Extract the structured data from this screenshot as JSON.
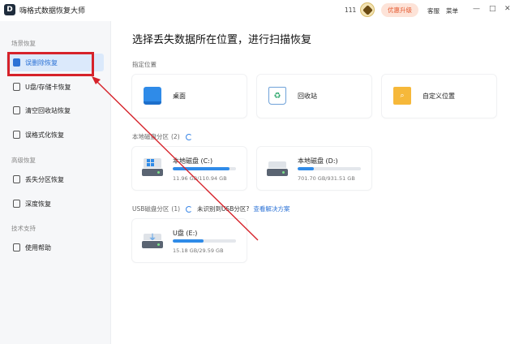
{
  "app": {
    "title": "嗨格式数据恢复大师",
    "logo_letter": "D"
  },
  "titlebar": {
    "count": "111",
    "upgrade_label": "优惠升级",
    "service_label": "客服",
    "menu_label": "菜单",
    "minimize_glyph": "—",
    "maximize_glyph": "□",
    "close_glyph": "✕"
  },
  "sidebar": {
    "sections": [
      {
        "label": "场景恢复",
        "items": [
          {
            "label": "误删除恢复",
            "icon": "file-delete-icon",
            "active": true
          },
          {
            "label": "U盘/存储卡恢复",
            "icon": "usb-icon"
          },
          {
            "label": "清空回收站恢复",
            "icon": "recycle-bin-icon"
          },
          {
            "label": "误格式化恢复",
            "icon": "format-icon"
          }
        ]
      },
      {
        "label": "高级恢复",
        "items": [
          {
            "label": "丢失分区恢复",
            "icon": "partition-icon"
          },
          {
            "label": "深度恢复",
            "icon": "deep-scan-icon"
          }
        ]
      },
      {
        "label": "技术支持",
        "items": [
          {
            "label": "使用帮助",
            "icon": "help-book-icon"
          }
        ]
      }
    ]
  },
  "main": {
    "title": "选择丢失数据所在位置，进行扫描恢复",
    "locations": {
      "label": "指定位置",
      "items": [
        {
          "label": "桌面",
          "icon": "desktop-icon"
        },
        {
          "label": "回收站",
          "icon": "recycle-bin-icon"
        },
        {
          "label": "自定义位置",
          "icon": "folder-search-icon"
        }
      ]
    },
    "local_disks": {
      "label": "本地磁盘分区",
      "count": "(2)",
      "items": [
        {
          "name": "本地磁盘 (C:)",
          "size": "11.96 GB/110.94 GB",
          "used_fraction": 0.9
        },
        {
          "name": "本地磁盘 (D:)",
          "size": "701.70 GB/931.51 GB",
          "used_fraction": 0.25
        }
      ]
    },
    "usb_disks": {
      "label": "USB磁盘分区",
      "count": "(1)",
      "warning": "未识别到USB分区?",
      "link": "查看解决方案",
      "items": [
        {
          "name": "U盘 (E:)",
          "size": "15.18 GB/29.59 GB",
          "used_fraction": 0.49
        }
      ]
    }
  },
  "colors": {
    "accent": "#2f8be8",
    "active_bg": "#dbe9fb",
    "annotation_red": "#d6222a",
    "upgrade_text": "#e4572e"
  }
}
